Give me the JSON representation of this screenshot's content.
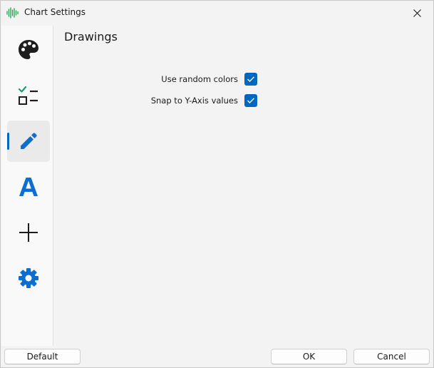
{
  "window": {
    "title": "Chart Settings"
  },
  "titlebar": {
    "app_icon": "waveform-icon",
    "close_icon": "close-icon"
  },
  "sidebar": {
    "items": [
      {
        "icon": "palette-icon",
        "active": false
      },
      {
        "icon": "checklist-icon",
        "active": false
      },
      {
        "icon": "pencil-icon",
        "active": true
      },
      {
        "icon": "font-icon",
        "active": false
      },
      {
        "icon": "plus-icon",
        "active": false
      },
      {
        "icon": "gear-icon",
        "active": false
      }
    ],
    "accent_color": "#0067c0"
  },
  "panel": {
    "title": "Drawings",
    "options": [
      {
        "label": "Use random colors",
        "checked": true
      },
      {
        "label": "Snap to Y-Axis values",
        "checked": true
      }
    ]
  },
  "footer": {
    "default_label": "Default",
    "ok_label": "OK",
    "cancel_label": "Cancel"
  }
}
